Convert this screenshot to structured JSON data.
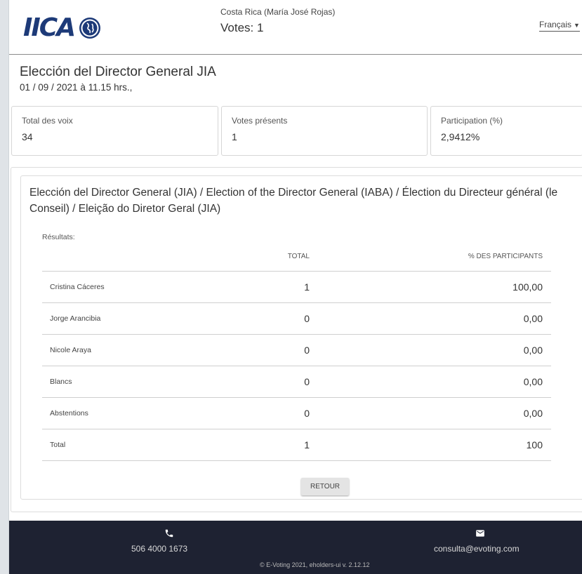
{
  "header": {
    "logo_text": "IICA",
    "user": "Costa Rica (María José Rojas)",
    "votes": "Votes: 1",
    "language": "Français"
  },
  "election": {
    "title": "Elección del Director General JIA",
    "date": "01 / 09 / 2021 à 11.15 hrs.,"
  },
  "stats": [
    {
      "label": "Total des voix",
      "value": "34"
    },
    {
      "label": "Votes présents",
      "value": "1"
    },
    {
      "label": "Participation (%)",
      "value": "2,9412%"
    }
  ],
  "question": {
    "title": "Elección del Director General (JIA) / Election of the Director General (IABA) / Élection du Directeur général (le Conseil) / Eleição do Diretor Geral (JIA)",
    "results_label": "Résultats:",
    "columns": {
      "name": "",
      "total": "TOTAL",
      "pct": "% DES PARTICIPANTS"
    },
    "rows": [
      {
        "name": "Cristina Cáceres",
        "total": "1",
        "pct": "100,00"
      },
      {
        "name": "Jorge Arancibia",
        "total": "0",
        "pct": "0,00"
      },
      {
        "name": "Nicole Araya",
        "total": "0",
        "pct": "0,00"
      },
      {
        "name": "Blancs",
        "total": "0",
        "pct": "0,00"
      },
      {
        "name": "Abstentions",
        "total": "0",
        "pct": "0,00"
      },
      {
        "name": "Total",
        "total": "1",
        "pct": "100"
      }
    ],
    "back_button": "RETOUR"
  },
  "footer": {
    "phone": "506 4000 1673",
    "email": "consulta@evoting.com",
    "copyright": "© E-Voting 2021, eholders-ui v. 2.12.12"
  },
  "colors": {
    "logo": "#1d3a78",
    "footer_bg": "#1e2232",
    "button_bg": "#e4e4e4"
  }
}
